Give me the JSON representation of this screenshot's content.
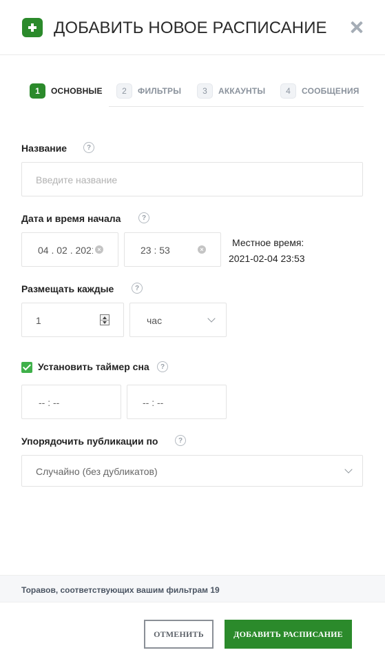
{
  "header": {
    "title": "ДОБАВИТЬ НОВОЕ РАСПИСАНИЕ",
    "add_icon": "plus-icon",
    "close_icon": "close-icon"
  },
  "tabs": [
    {
      "num": "1",
      "label": "ОСНОВНЫЕ",
      "active": true
    },
    {
      "num": "2",
      "label": "ФИЛЬТРЫ",
      "active": false
    },
    {
      "num": "3",
      "label": "АККАУНТЫ",
      "active": false
    },
    {
      "num": "4",
      "label": "СООБЩЕНИЯ",
      "active": false
    }
  ],
  "form": {
    "name": {
      "label": "Название",
      "placeholder": "Введите название",
      "help": "?"
    },
    "start": {
      "label": "Дата и время начала",
      "date_value": "04 . 02 . 2021",
      "time_value": "23 : 53",
      "help": "?",
      "clear": "×"
    },
    "local_time": {
      "label": "Местное время:",
      "value": "2021-02-04 23:53"
    },
    "interval": {
      "label": "Размещать каждые",
      "value": "1",
      "unit": "час",
      "help": "?"
    },
    "sleep_timer": {
      "label": "Установить таймер сна",
      "checked": true,
      "from_value": "-- : --",
      "to_value": "-- : --",
      "help": "?"
    },
    "order": {
      "label": "Упорядочить публикации по",
      "value": "Случайно (без дубликатов)",
      "help": "?"
    }
  },
  "footer": {
    "matches_text": "Торавов, соответствующих вашим фильтрам 19"
  },
  "buttons": {
    "cancel": "ОТМЕНИТЬ",
    "add": "ДОБАВИТЬ РАСПИСАНИЕ"
  },
  "colors": {
    "accent": "#2b8a2b",
    "checkbox": "#3fb04a"
  }
}
